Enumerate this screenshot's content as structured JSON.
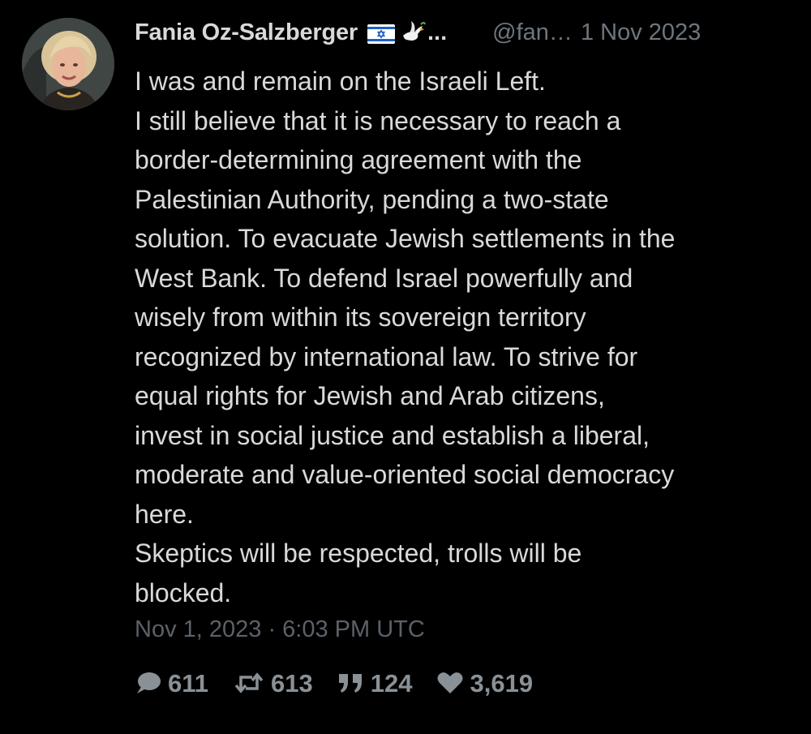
{
  "author": {
    "display_name": "Fania Oz-Salzberger",
    "name_ellipsis": "...",
    "flag_icon": "israel-flag-icon",
    "emoji_icon": "dove-icon",
    "handle": "@fan…",
    "date_short": "1 Nov 2023",
    "avatar": "profile-photo"
  },
  "tweet": {
    "lines": [
      "I was and remain on the Israeli Left.",
      "I still believe that it is necessary to reach a",
      "border-determining agreement with the",
      "Palestinian Authority, pending a two-state",
      "solution. To evacuate Jewish settlements in the",
      "West Bank. To defend Israel powerfully and",
      "wisely from within its sovereign territory",
      "recognized by international law. To strive for",
      "equal rights for Jewish and Arab citizens,",
      "invest in social justice and establish a liberal,",
      "moderate and value-oriented social democracy",
      "here.",
      "Skeptics will be respected, trolls will be",
      "blocked."
    ],
    "timestamp": "Nov 1, 2023 · 6:03 PM UTC"
  },
  "stats": {
    "replies": "611",
    "retweets": "613",
    "quotes": "124",
    "likes": "3,619"
  },
  "colors": {
    "background": "#000000",
    "text": "#d9d9d9",
    "muted": "#6e767d",
    "stats": "#8a9196"
  }
}
